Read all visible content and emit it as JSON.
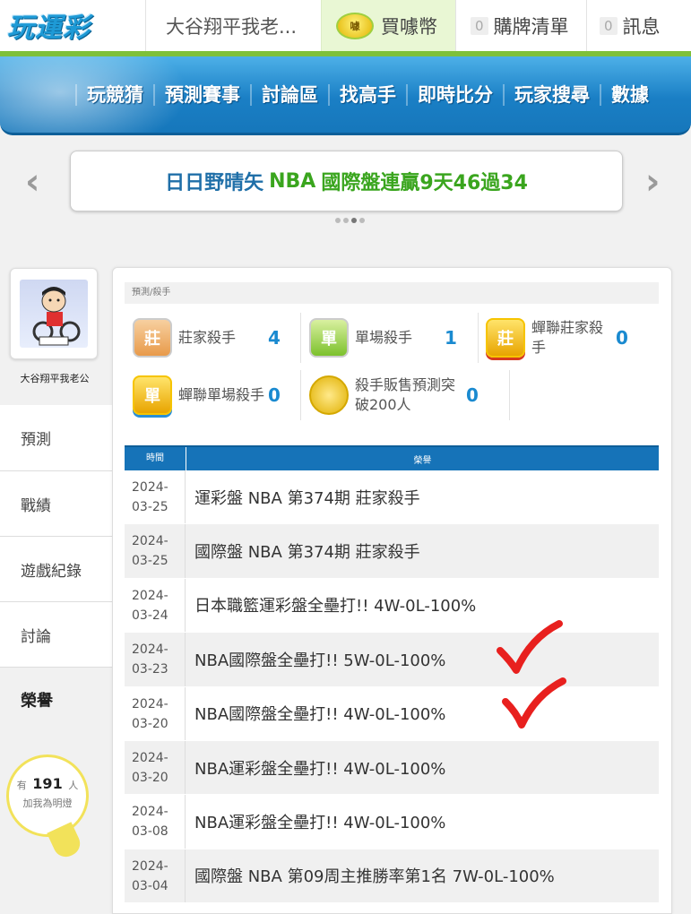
{
  "topbar": {
    "logo": "玩運彩",
    "username": "大谷翔平我老...",
    "coin_icon": "coin-icon",
    "coin_label": "買噱幣",
    "cart_count": "0",
    "cart_label": "購牌清單",
    "msg_count": "0",
    "msg_label": "訊息"
  },
  "nav": {
    "items": [
      "玩競猜",
      "預測賽事",
      "討論區",
      "找高手",
      "即時比分",
      "玩家搜尋",
      "數據"
    ]
  },
  "banner": {
    "name": "日日野晴矢",
    "league": "NBA",
    "text": "國際盤連贏9天46過34"
  },
  "sidebar": {
    "username": "大谷翔平我老公",
    "menu": [
      "預測",
      "戰績",
      "遊戲紀錄",
      "討論",
      "榮譽"
    ],
    "active": "榮譽",
    "likes_prefix": "有",
    "likes_count": "191",
    "likes_suffix": "人",
    "likes_text": "加我為明燈"
  },
  "breadcrumb": "預測/殺手",
  "stats": [
    {
      "badge": "莊",
      "label": "莊家殺手",
      "value": "4"
    },
    {
      "badge": "單",
      "label": "單場殺手",
      "value": "1"
    },
    {
      "badge": "莊",
      "label": "蟬聯莊家殺手",
      "value": "0"
    },
    {
      "badge": "單",
      "label": "蟬聯單場殺手",
      "value": "0"
    },
    {
      "badge": "",
      "label": "殺手販售預測突破200人",
      "value": "0"
    }
  ],
  "table": {
    "headers": {
      "time": "時間",
      "honor": "榮譽"
    },
    "rows": [
      {
        "year": "2024-",
        "date": "03-25",
        "honor": "運彩盤 NBA 第374期 莊家殺手"
      },
      {
        "year": "2024-",
        "date": "03-25",
        "honor": "國際盤 NBA 第374期 莊家殺手"
      },
      {
        "year": "2024-",
        "date": "03-24",
        "honor": "日本職籃運彩盤全壘打!! 4W-0L-100%"
      },
      {
        "year": "2024-",
        "date": "03-23",
        "honor": "NBA國際盤全壘打!! 5W-0L-100%"
      },
      {
        "year": "2024-",
        "date": "03-20",
        "honor": "NBA國際盤全壘打!! 4W-0L-100%"
      },
      {
        "year": "2024-",
        "date": "03-20",
        "honor": "NBA運彩盤全壘打!! 4W-0L-100%"
      },
      {
        "year": "2024-",
        "date": "03-08",
        "honor": "NBA運彩盤全壘打!! 4W-0L-100%"
      },
      {
        "year": "2024-",
        "date": "03-04",
        "honor": "國際盤 NBA 第09周主推勝率第1名 7W-0L-100%"
      }
    ]
  },
  "colors": {
    "accent": "#1a8ad0",
    "nav": "#1a7fc5",
    "green": "#3aa51e",
    "check": "#e8201e"
  }
}
